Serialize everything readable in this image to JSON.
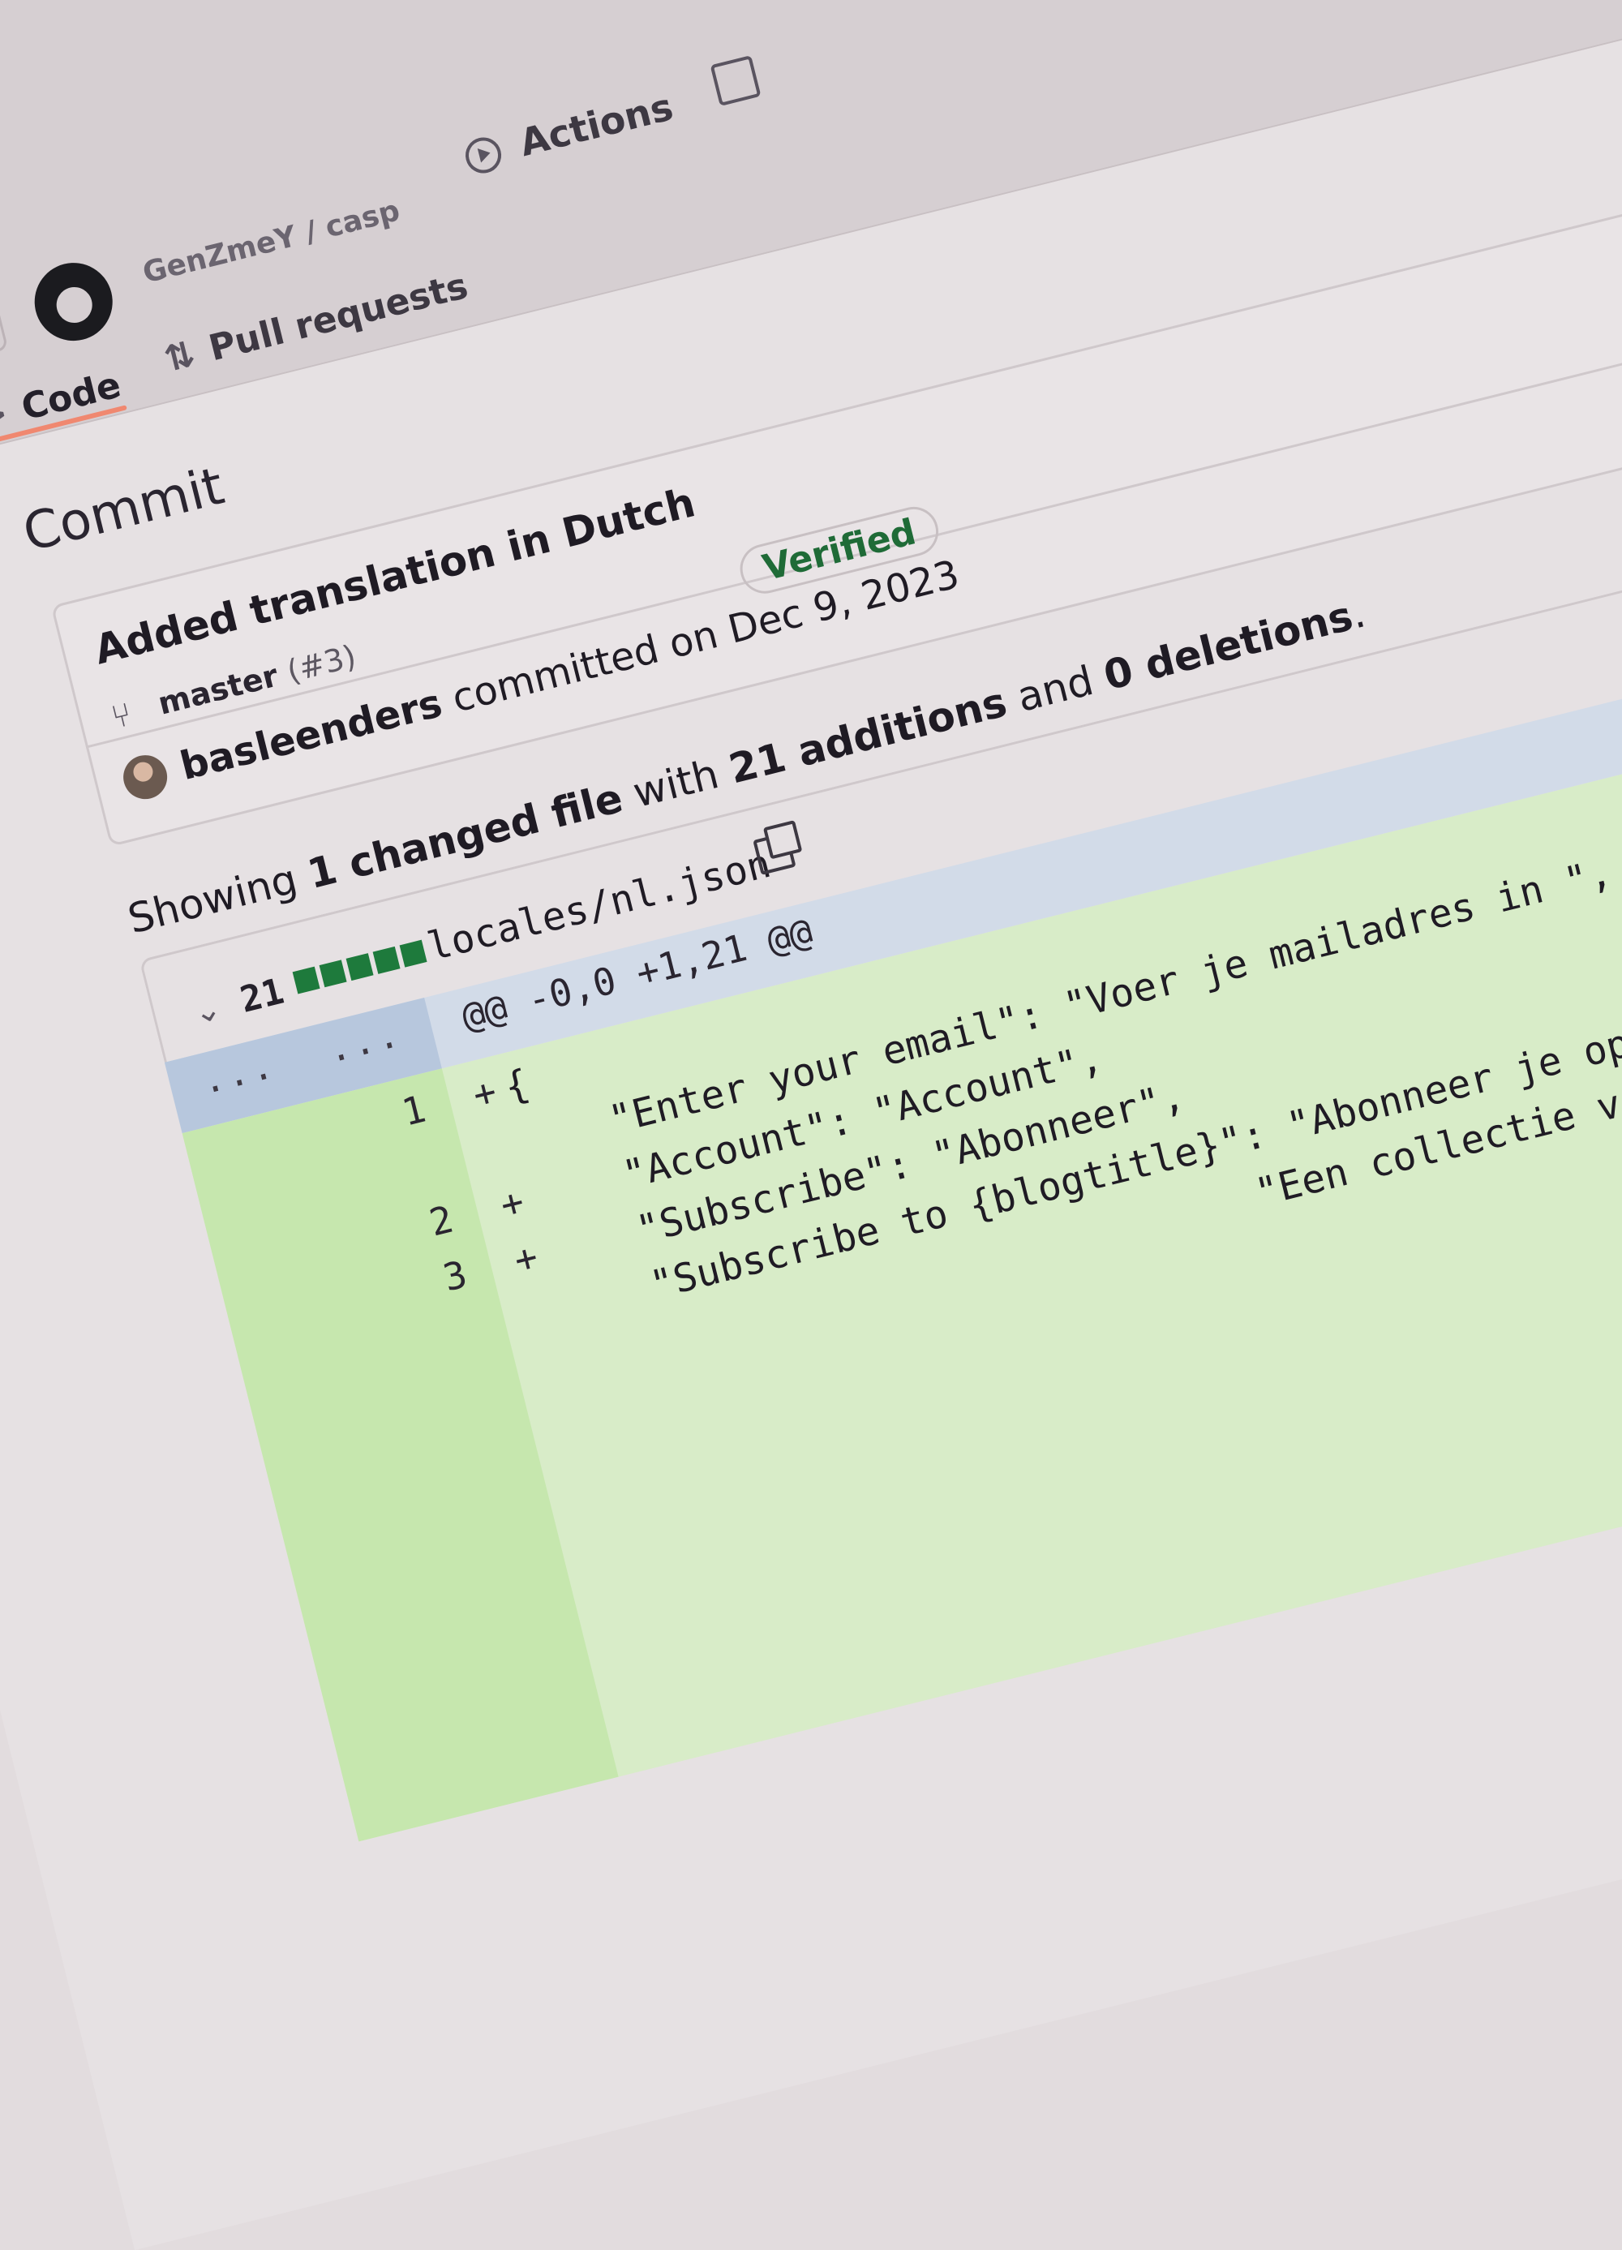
{
  "header": {
    "menu_icon": "hamburger-icon",
    "logo_icon": "github-octocat-icon",
    "repo_path": "GenZmeY / casp",
    "actions_label": "Actions",
    "projects_icon": "table-icon"
  },
  "tabs": {
    "code_label": "Code",
    "pull_requests_label": "Pull requests"
  },
  "page": {
    "heading": "Commit"
  },
  "commit": {
    "title": "Added translation in Dutch",
    "branch": "master",
    "pr_ref": "(#3)",
    "author": "basleenders",
    "committed_text": "committed on Dec 9, 2023",
    "badge": "Verified"
  },
  "summary": {
    "prefix": "Showing",
    "changed": "1 changed file",
    "with": "with",
    "additions": "21 additions",
    "and": "and",
    "deletions": "0 deletions",
    "end": "."
  },
  "file": {
    "change_count": "21",
    "added_blocks": 5,
    "name": "locales/nl.json",
    "hunk_header": "@@ -0,0 +1,21 @@",
    "hunk_dots_left": "...",
    "hunk_dots_right": "...",
    "lines": [
      {
        "num": "1",
        "sign": "+",
        "text": "{"
      },
      {
        "num": "",
        "sign": "",
        "text": "    \"Enter your email\": \"Voer je mailadres in \","
      },
      {
        "num": "2",
        "sign": "+",
        "text": "    \"Account\": \"Account\","
      },
      {
        "num": "3",
        "sign": "+",
        "text": "    \"Subscribe\": \"Abonneer\","
      },
      {
        "num": "",
        "sign": "",
        "text": "    \"Subscribe to {blogtitle}\": \"Abonneer je op {bl"
      },
      {
        "num": "",
        "sign": "",
        "text": "                              \"Een collectie van be"
      }
    ]
  },
  "colors": {
    "verified_green": "#1f6b37",
    "addition_block": "#1e7a3c",
    "addition_row": "#d8ecc8",
    "hunk_row": "#d2dbe8",
    "active_tab_underline": "#f08870"
  }
}
